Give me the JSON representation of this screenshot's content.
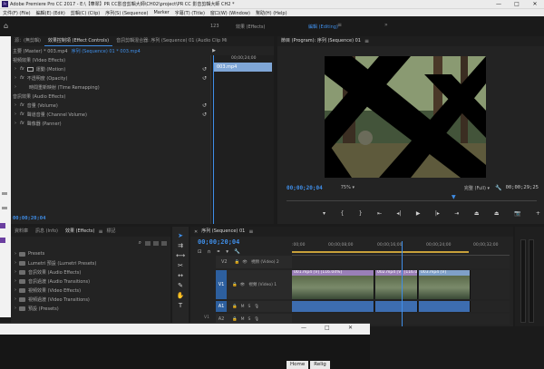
{
  "window": {
    "title": "Adobe Premiere Pro CC 2017 - E:\\【華翠】PR CC影音剪輯大師\\CH02\\project\\PR CC 影音剪輯大師 CH2 *",
    "controls": {
      "minimize": "—",
      "maximize": "□",
      "close": "✕"
    }
  },
  "menubar": [
    "文件(F) (File)",
    "編輯(E) (Edit)",
    "剪輯(C) (Clip)",
    "序列(S) (Sequence)",
    "Marker",
    "字幕(T) (Title)",
    "窗口(W) (Window)",
    "幫助(H) (Help)"
  ],
  "workspaces": [
    "123",
    "效果 (Effects)",
    "編輯 (Editing)"
  ],
  "workspace_active": 2,
  "source_panel": {
    "tabs": [
      "源：(無剪輯)",
      "效果控制項 (Effect Controls)",
      "音訊剪輯混合器: 序列 (Sequence) 01 (Audio Clip Mi"
    ],
    "active_tab": 1,
    "master": "主要 (Master) * 003.mp4",
    "sequence": "序列 (Sequence) 01 * 003.mp4",
    "mini_timecode": "00;00;24;00",
    "mini_clip": "003.mp4",
    "video_header": "視頻效果 (Video Effects)",
    "video_effects": [
      "運動 (Motion)",
      "不透明度 (Opacity)",
      "時間重新映射 (Time Remapping)"
    ],
    "audio_header": "音訊效果 (Audio Effects)",
    "audio_effects": [
      "音量 (Volume)",
      "聲道音量 (Channel Volume)",
      "聲像器 (Panner)"
    ],
    "fx_glyph": "fx",
    "timecode": "00;00;20;04"
  },
  "program_monitor": {
    "tab": "節目 (Program): 序列 (Sequence) 01",
    "timecode": "00;00;20;04",
    "zoom": "75%",
    "quality": "完整 (Full)",
    "duration": "00;00;29;25"
  },
  "project_panel": {
    "tabs": [
      "資料庫",
      "訊息 (Info)",
      "效果 (Effects)",
      "標記"
    ],
    "active_tab": 2,
    "items": [
      "Presets",
      "Lumetri 預設 (Lumetri Presets)",
      "音訊效果 (Audio Effects)",
      "音訊過渡 (Audio Transitions)",
      "視頻效果 (Video Effects)",
      "視頻過渡 (Video Transitions)",
      "預設 (Presets)"
    ]
  },
  "timeline": {
    "tab": "序列 (Sequence) 01",
    "timecode": "00;00;20;04",
    "ruler": [
      ":00;00",
      "00;00;08;00",
      "00;00;16;00",
      "00;00;24;00",
      "00;00;32;00"
    ],
    "playhead": 0.505,
    "tracks": [
      {
        "label": "V2",
        "name": "視頻 (Video) 2"
      },
      {
        "label": "V1",
        "name": "視頻 (Video) 1"
      },
      {
        "label": "A1",
        "name": ""
      },
      {
        "label": "A2",
        "name": ""
      }
    ],
    "clips": [
      {
        "label": "001.mp4 [V] [116.04%]",
        "start": 0.0,
        "end": 0.385,
        "color": "#9a7fb8"
      },
      {
        "label": "002.mp4 [V] [116.04%]",
        "start": 0.385,
        "end": 0.585,
        "color": "#9a7fb8"
      },
      {
        "label": "003.mp4 [V]",
        "start": 0.585,
        "end": 0.825,
        "color": "#7fa0c8"
      }
    ],
    "audio_clip_color": "#3d6db0",
    "track_toggles": {
      "eye": "👁",
      "lock": "🔒",
      "mute": "M",
      "solo": "S",
      "mic": "🎙"
    }
  },
  "bottom_tabs": [
    "Home",
    "Relig"
  ],
  "colors": {
    "accent": "#3f8ee8",
    "playhead": "#3f8ee8",
    "clip_video": "#9a7fb8"
  }
}
